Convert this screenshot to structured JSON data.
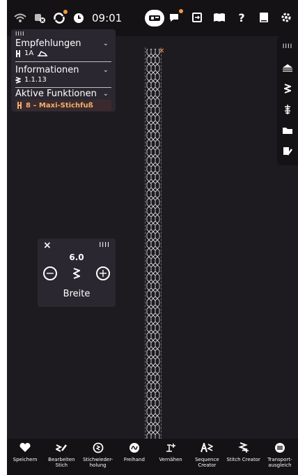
{
  "status": {
    "time": "09:01"
  },
  "left_panel": {
    "grip_label": "IIII",
    "sections": [
      {
        "title": "Empfehlungen",
        "sub": "1A"
      },
      {
        "title": "Informationen",
        "sub": "1.1.13"
      },
      {
        "title": "Aktive Funktionen",
        "sub": "8 – Maxi-Stichfuß"
      }
    ]
  },
  "right_tools": {
    "grip_label": "IIII"
  },
  "width_control": {
    "value": "6.0",
    "label": "Breite",
    "grip_label": "IIII",
    "close_glyph": "×"
  },
  "bottom_bar": {
    "items": [
      {
        "label": "Speichern",
        "icon": "heart-icon"
      },
      {
        "label": "Bearbeiten Stich",
        "icon": "edit-stitch-icon"
      },
      {
        "label": "Stichwieder- holung",
        "icon": "repeat-icon"
      },
      {
        "label": "Freihand",
        "icon": "freehand-icon"
      },
      {
        "label": "Vernähen",
        "icon": "tie-off-icon"
      },
      {
        "label": "Sequence Creator",
        "icon": "sequence-creator-icon"
      },
      {
        "label": "Stitch Creator",
        "icon": "stitch-creator-icon"
      },
      {
        "label": "Transport- ausgleich",
        "icon": "feed-balance-icon"
      }
    ]
  },
  "colors": {
    "background": "#1d1b1f",
    "panel": "#2b2730",
    "accent": "#f39a45"
  }
}
